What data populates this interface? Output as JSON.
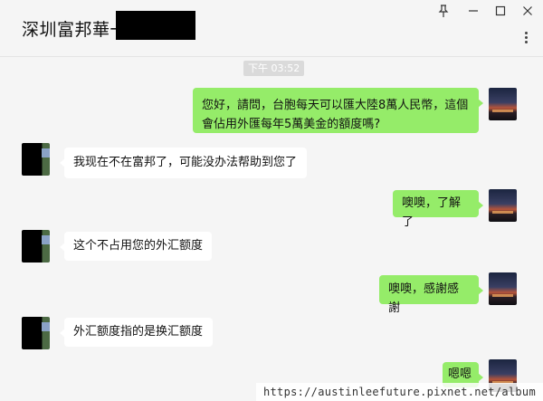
{
  "header": {
    "title": "深圳富邦華一",
    "icons": [
      "pin-icon",
      "minimize-icon",
      "maximize-icon",
      "close-icon",
      "more-icon"
    ]
  },
  "chat": {
    "timestamp": "下午 03:52",
    "messages": [
      {
        "sender": "me",
        "text": "您好，請問，台胞每天可以匯大陸8萬人民幣，這個會佔用外匯每年5萬美金的額度嗎?"
      },
      {
        "sender": "other",
        "text": "我现在不在富邦了，可能没办法帮助到您了"
      },
      {
        "sender": "me",
        "text": "噢噢，了解了"
      },
      {
        "sender": "other",
        "text": "这个不占用您的外汇额度"
      },
      {
        "sender": "me",
        "text": "噢噢，感謝感謝"
      },
      {
        "sender": "other",
        "text": "外汇额度指的是换汇额度"
      },
      {
        "sender": "me",
        "text": "嗯嗯"
      }
    ]
  },
  "watermark": "https://austinleefuture.pixnet.net/album",
  "colors": {
    "my_bubble": "#95ec69",
    "their_bubble": "#ffffff",
    "background": "#f5f5f5"
  }
}
